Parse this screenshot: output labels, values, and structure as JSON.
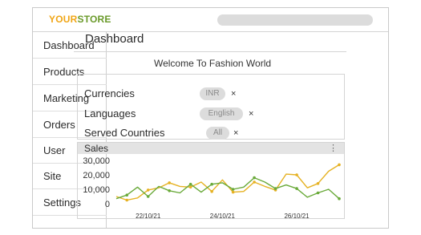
{
  "logo": {
    "part1": "YOUR",
    "part2": "STORE"
  },
  "sidebar": {
    "items": [
      {
        "label": "Dashboard"
      },
      {
        "label": "Products"
      },
      {
        "label": "Marketing"
      },
      {
        "label": "Orders"
      },
      {
        "label": "User"
      },
      {
        "label": "Site"
      },
      {
        "label": "Settings"
      }
    ]
  },
  "main": {
    "title": "Dashboard",
    "welcome": "Welcome To Fashion World"
  },
  "settings": {
    "currencies": {
      "label": "Currencies",
      "value": "INR",
      "remove": "×"
    },
    "languages": {
      "label": "Languages",
      "value": "English",
      "remove": "×"
    },
    "countries": {
      "label": "Served Countries",
      "value": "All",
      "remove": "×"
    }
  },
  "sales": {
    "title": "Sales",
    "menu_icon": "⋮"
  },
  "colors": {
    "brand_orange": "#f0a616",
    "brand_green": "#6a9a2a",
    "series_orange": "#e6b224",
    "series_green": "#6aaa3a"
  },
  "chart_data": {
    "type": "line",
    "ylim": [
      0,
      35000
    ],
    "yticks": [
      "30,000",
      "20,000",
      "10,000",
      "0"
    ],
    "ytick_values": [
      30000,
      20000,
      10000,
      0
    ],
    "xlabels": [
      "22/10/21",
      "24/10/21",
      "26/10/21"
    ],
    "xlabel_index": [
      3,
      10,
      17
    ],
    "series": [
      {
        "color": "#e6b224",
        "values": [
          5000,
          2500,
          4000,
          9500,
          11000,
          14500,
          12000,
          11500,
          15000,
          8500,
          16500,
          8000,
          8500,
          15000,
          12000,
          9500,
          20500,
          20000,
          11000,
          14000,
          22500,
          27000
        ]
      },
      {
        "color": "#6aaa3a",
        "values": [
          3500,
          6000,
          11500,
          5000,
          12000,
          9000,
          7500,
          13500,
          8000,
          13500,
          14500,
          10000,
          11500,
          18000,
          15000,
          10500,
          13000,
          10500,
          4500,
          7500,
          10000,
          3500
        ]
      }
    ]
  }
}
